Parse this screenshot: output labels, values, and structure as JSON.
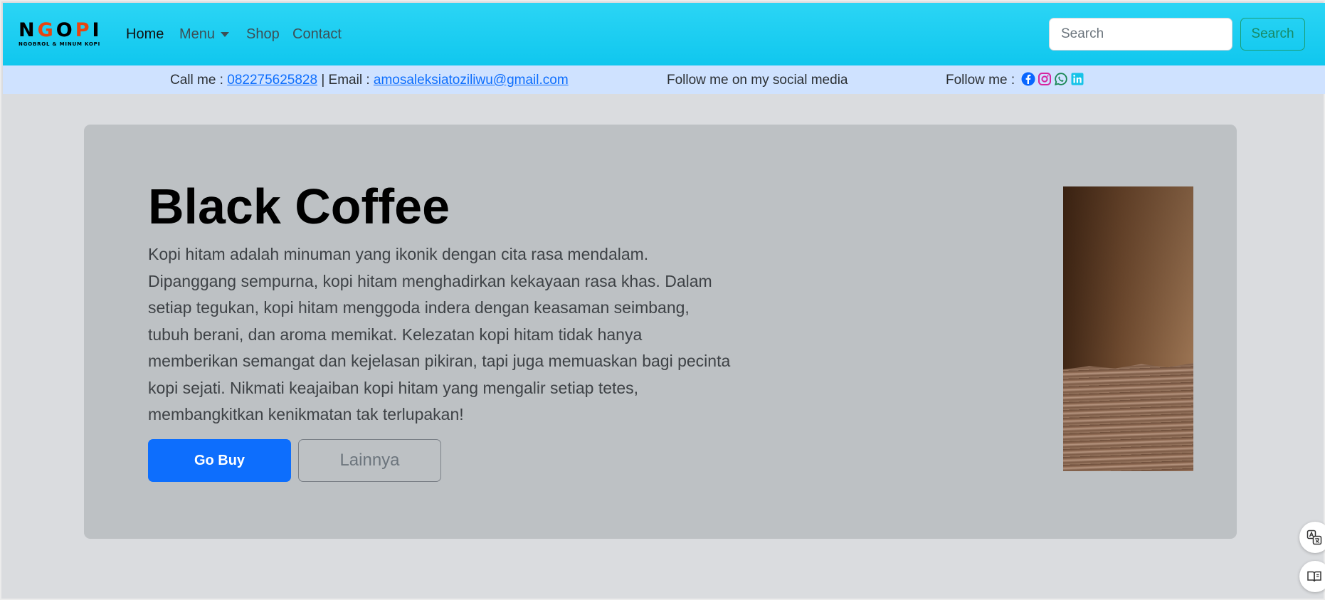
{
  "brand": {
    "logo_main": "NGOPI",
    "logo_sub": "NGOBROL & MINUM KOPI"
  },
  "nav": {
    "home": "Home",
    "menu": "Menu",
    "shop": "Shop",
    "contact": "Contact"
  },
  "search": {
    "placeholder": "Search",
    "button_label": "Search"
  },
  "infobar": {
    "call_label": "Call me : ",
    "phone": "082275625828",
    "email_label": " | Email : ",
    "email": "amosaleksiatoziliwu@gmail.com",
    "social_text": "Follow me on my social media",
    "follow_label": "Follow me : ",
    "social_icons": [
      "facebook-icon",
      "instagram-icon",
      "whatsapp-icon",
      "linkedin-icon"
    ]
  },
  "hero": {
    "title": "Black Coffee",
    "description": "Kopi hitam adalah minuman yang ikonik dengan cita rasa mendalam. Dipanggang sempurna, kopi hitam menghadirkan kekayaan rasa khas. Dalam setiap tegukan, kopi hitam menggoda indera dengan keasaman seimbang, tubuh berani, dan aroma memikat. Kelezatan kopi hitam tidak hanya memberikan semangat dan kejelasan pikiran, tapi juga memuaskan bagi pecinta kopi sejati. Nikmati keajaiban kopi hitam yang mengalir setiap tetes, membangkitkan kenikmatan tak terlupakan!",
    "buy_label": "Go Buy",
    "more_label": "Lainnya"
  },
  "colors": {
    "navbar": "#1ccdf2",
    "infobar": "#cfe2ff",
    "primary": "#0d6efd",
    "success_outline": "#198754",
    "card": "#bdc1c4",
    "page_bg": "#dadcdf"
  }
}
